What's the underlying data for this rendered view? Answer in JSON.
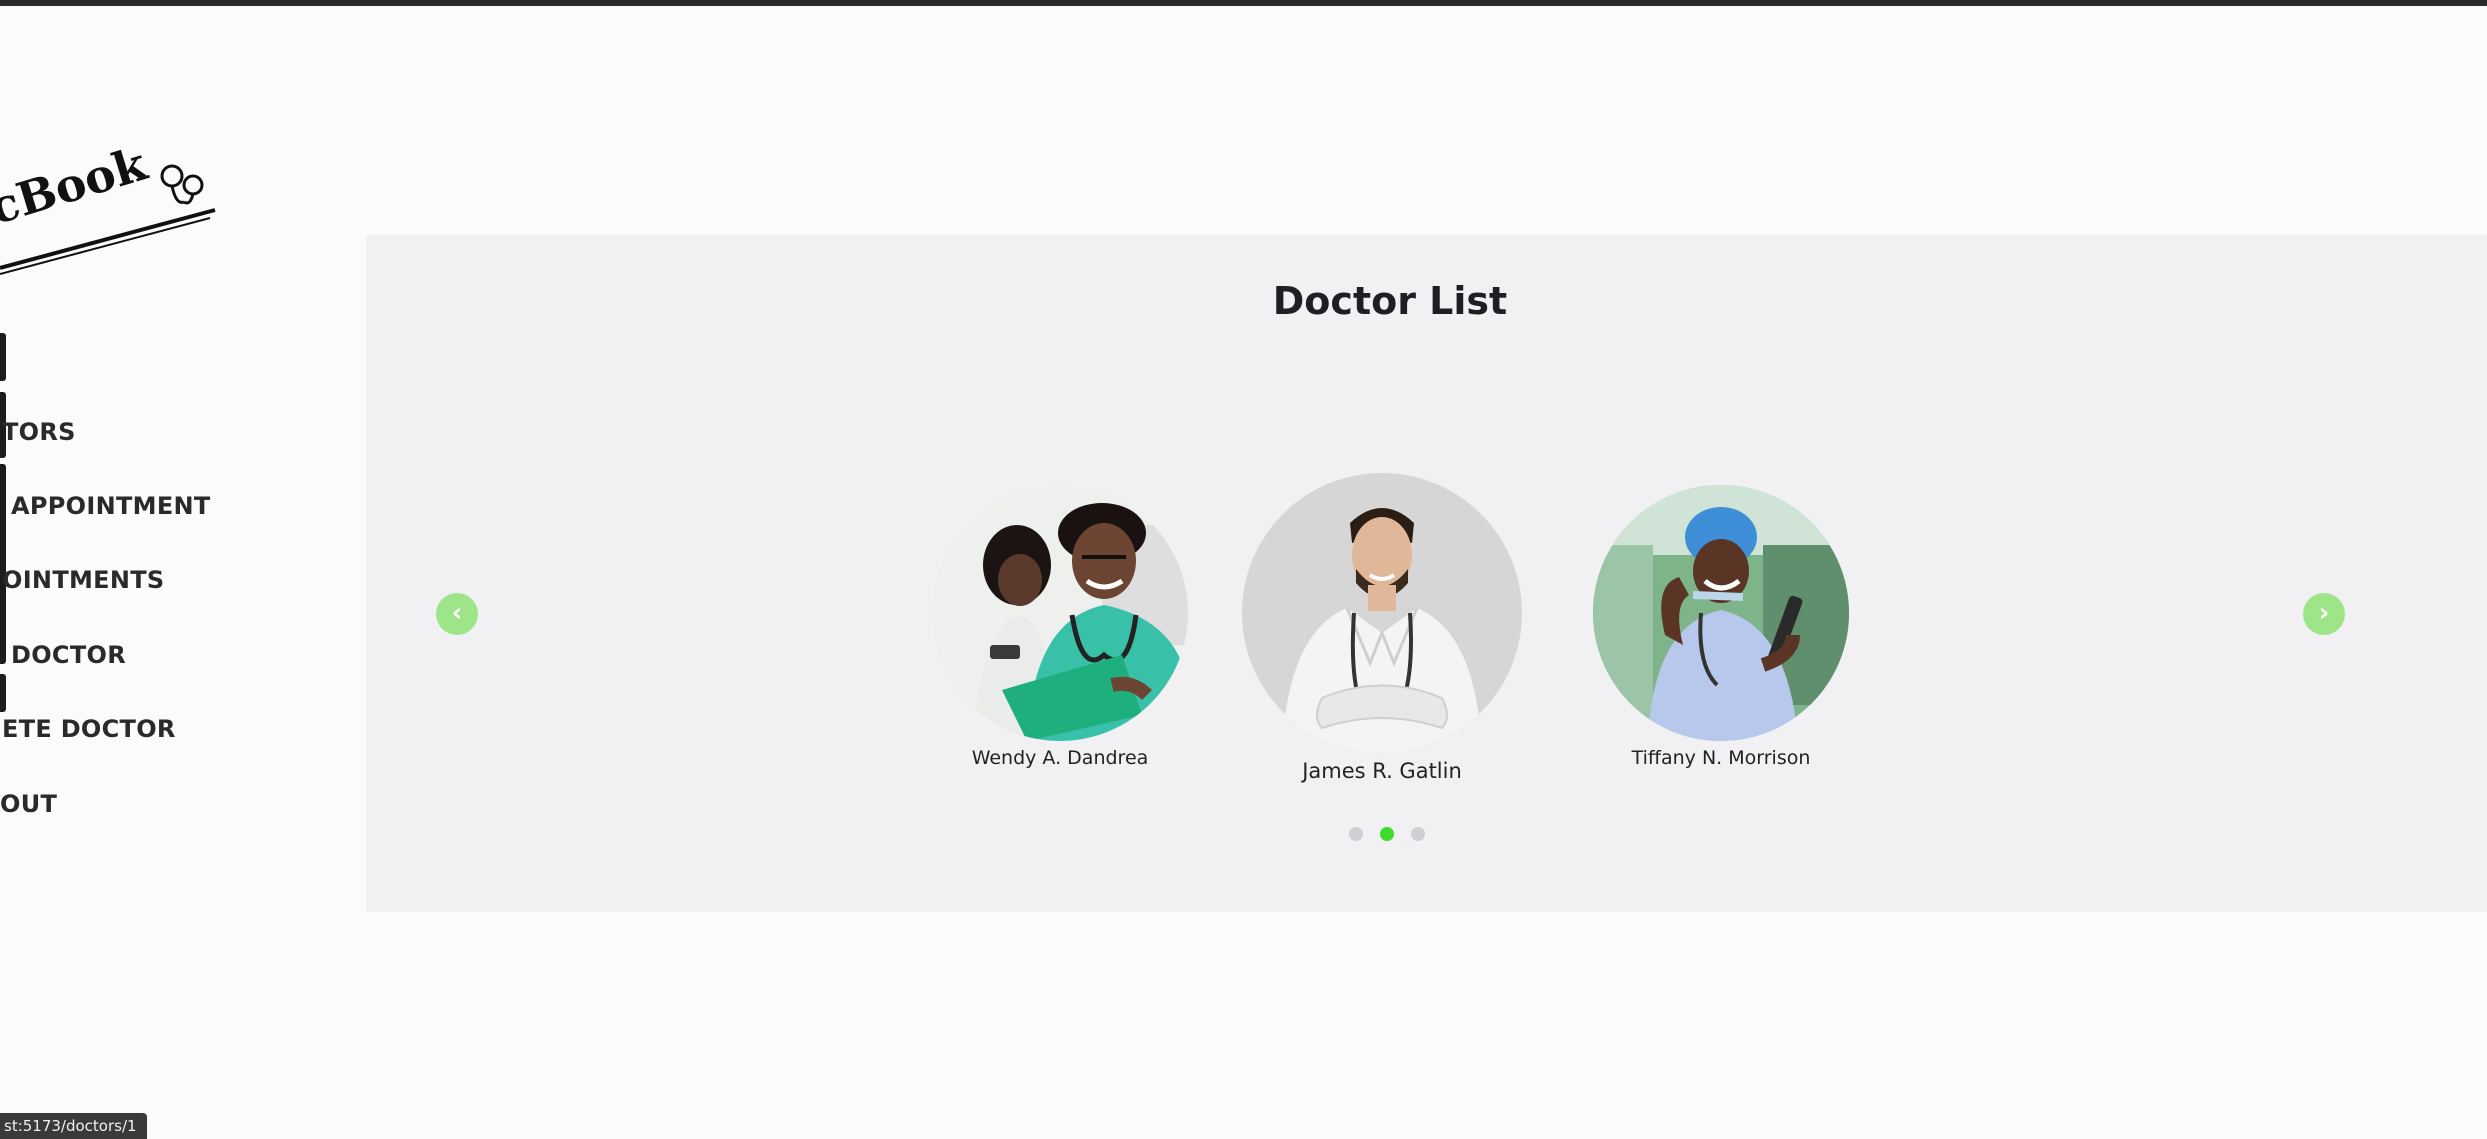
{
  "brand": {
    "logo_text": "ocBook"
  },
  "sidebar": {
    "items": [
      {
        "label": ""
      },
      {
        "label": "TORS"
      },
      {
        "label": "APPOINTMENT"
      },
      {
        "label": "OINTMENTS"
      },
      {
        "label": "DOCTOR"
      },
      {
        "label": "ETE DOCTOR"
      },
      {
        "label": "OUT"
      }
    ]
  },
  "main": {
    "title": "Doctor List",
    "carousel": {
      "prev_icon": "chevron-left-icon",
      "next_icon": "chevron-right-icon",
      "prev_glyph": "‹",
      "next_glyph": "›",
      "doctors": [
        {
          "name": "Wendy A. Dandrea"
        },
        {
          "name": "James R. Gatlin"
        },
        {
          "name": "Tiffany N. Morrison"
        }
      ],
      "pages": 3,
      "active_page": 2
    }
  },
  "status_bar": {
    "url": "st:5173/doctors/1"
  },
  "colors": {
    "accent_green": "#9ee58a",
    "dot_active": "#3ddc2a",
    "panel_bg": "#f1f1f4"
  }
}
